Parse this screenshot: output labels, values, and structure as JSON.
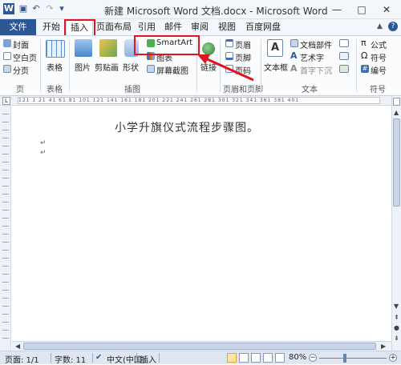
{
  "title": "新建 Microsoft Word 文档.docx - Microsoft Word",
  "app_icon": "word-icon",
  "quick_access": {
    "save": "save-icon",
    "undo": "undo-icon",
    "redo": "redo-icon",
    "customize": "dropdown-icon"
  },
  "window_buttons": {
    "help": "help-icon",
    "minimize": "—",
    "maximize": "□",
    "close": "✕"
  },
  "tabs": [
    "文件",
    "开始",
    "插入",
    "页面布局",
    "引用",
    "邮件",
    "审阅",
    "视图",
    "百度网盘"
  ],
  "active_tab": "插入",
  "ribbon": {
    "pages": {
      "items": [
        "封面",
        "空白页",
        "分页"
      ],
      "label": "页"
    },
    "tables": {
      "button": "表格",
      "label": "表格"
    },
    "illustrations": {
      "items": [
        "图片",
        "剪贴画",
        "形状"
      ],
      "smartart": "SmartArt",
      "chart": "图表",
      "screenshot": "屏幕截图",
      "label": "插图"
    },
    "links": {
      "button": "链接"
    },
    "header_footer": {
      "items": [
        "页眉",
        "页脚",
        "页码"
      ],
      "label": "页眉和页脚"
    },
    "text": {
      "items": [
        "文本框",
        "文档部件",
        "艺术字",
        "首字下沉"
      ],
      "label": "文本"
    },
    "symbols": {
      "items": [
        "公式",
        "符号",
        "编号"
      ],
      "label": "符号"
    }
  },
  "document": {
    "title_line": "小学升旗仪式流程步骤图。",
    "para_marks": [
      "↵",
      "↵"
    ]
  },
  "ruler_scale": "121 1 21 41 61 81 101 121 141 161 181 201 221 241 261 281 301 321 341 361 381 401",
  "status": {
    "page": "页面: 1/1",
    "words": "字数: 11",
    "language": "中文(中国)",
    "mode": "插入",
    "zoom": "80%"
  },
  "colors": {
    "accent": "#2b5797",
    "highlight": "#e0141e"
  }
}
